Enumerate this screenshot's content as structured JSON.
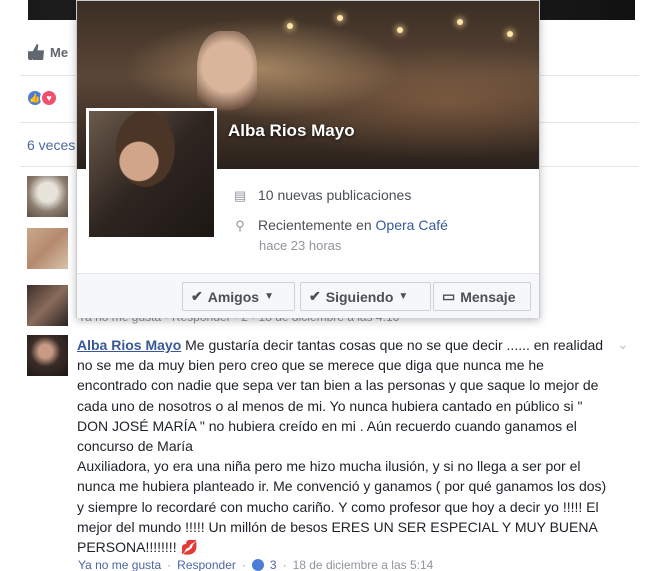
{
  "feed": {
    "like_action_label": "Me",
    "shares_text": "6 veces",
    "behind_meta": "Ya no me gusta · Responder · 2 · 18 de diciembre a las 4:16"
  },
  "comment": {
    "author": "Alba Rios Mayo",
    "text": "Me gustaría decir tantas cosas que no se que decir ...... en realidad no se me da muy bien pero creo que se merece que diga que nunca me he encontrado con nadie que sepa ver tan bien a las personas y que saque lo mejor de cada uno de nosotros o al menos de mi. Yo nunca hubiera cantado en público si \" DON JOSÉ MARÍA \" no hubiera creído en mi . Aún recuerdo cuando ganamos el concurso de María",
    "text2": "Auxiliadora, yo era una niña pero me hizo mucha ilusión, y si no llega a ser por el nunca me hubiera planteado ir. Me convenció y ganamos ( por qué ganamos los dos) y siempre lo recordaré con mucho cariño. Y como profesor que hoy a decir yo !!!!! El mejor del mundo !!!!! Un millón de besos ERES UN SER ESPECIAL Y MUY BUENA PERSONA!!!!!!!! ",
    "emoji": "💋",
    "footer": {
      "unlike": "Ya no me gusta",
      "reply": "Responder",
      "likes_count": "3",
      "timestamp": "18 de diciembre a las 5:14"
    }
  },
  "hovercard": {
    "name": "Alba Rios Mayo",
    "posts_line": "10 nuevas publicaciones",
    "recent_prefix": "Recientemente en ",
    "recent_place": "Opera Café",
    "recent_time": "hace 23 horas",
    "buttons": {
      "friends": "Amigos",
      "following": "Siguiendo",
      "message": "Mensaje"
    }
  },
  "colors": {
    "link": "#385898",
    "like_blue": "#4a7dd6",
    "love_red": "#f0506b"
  }
}
